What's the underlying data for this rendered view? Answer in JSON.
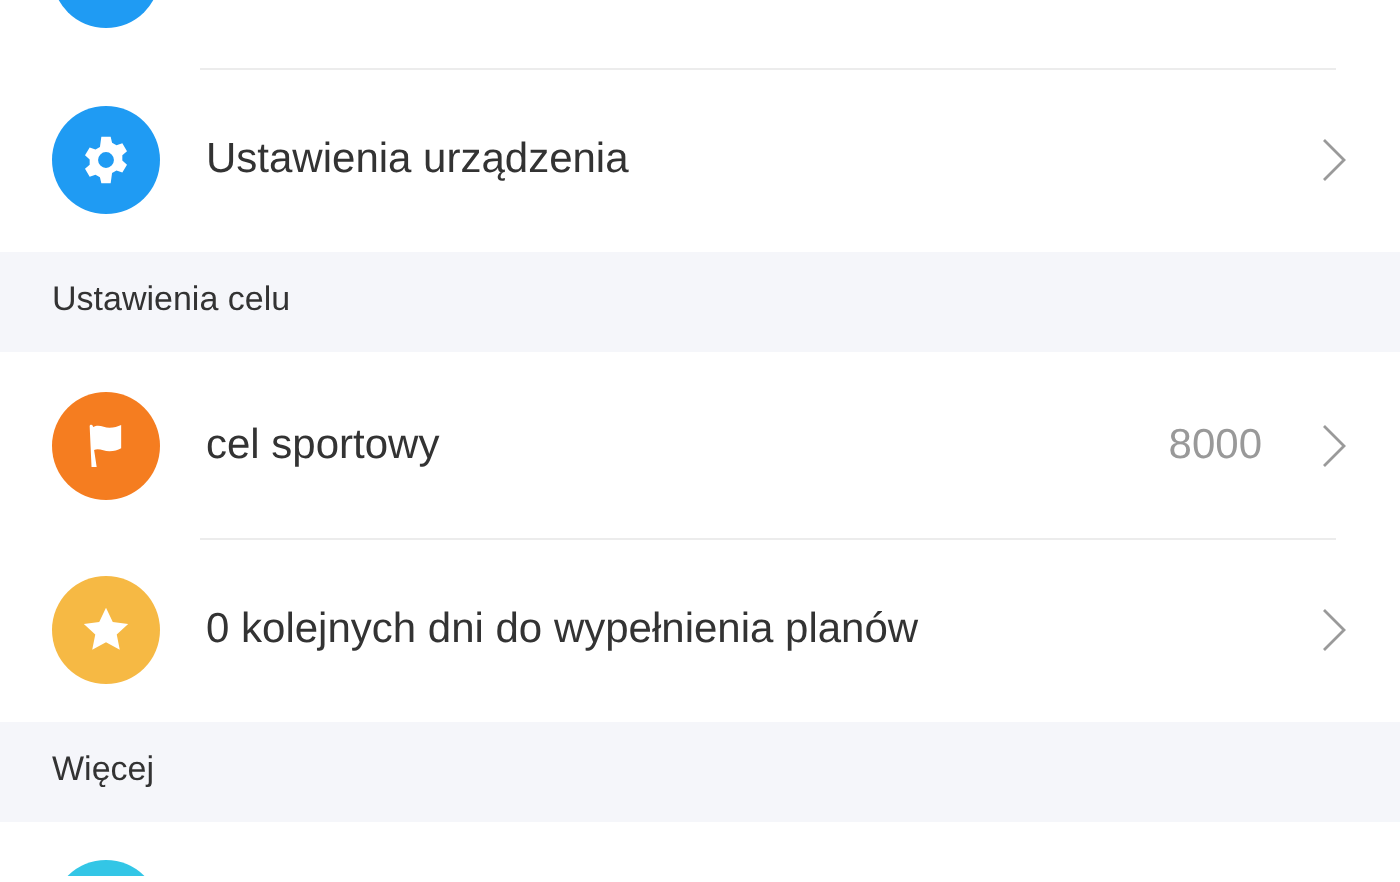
{
  "sections": [
    {
      "items": [
        {
          "kind": "cut-top",
          "color": "#1f9bf3"
        },
        {
          "kind": "gear",
          "color": "#1f9bf3",
          "label": "Ustawienia urządzenia"
        }
      ]
    },
    {
      "header": "Ustawienia celu",
      "items": [
        {
          "kind": "flag",
          "color": "#f57d20",
          "label": "cel sportowy",
          "value": "8000"
        },
        {
          "kind": "star",
          "color": "#f6b944",
          "label": "0 kolejnych dni do wypełnienia planów"
        }
      ]
    },
    {
      "header": "Więcej",
      "items": [
        {
          "kind": "cut-bottom",
          "color": "#33c6e6"
        }
      ]
    }
  ]
}
